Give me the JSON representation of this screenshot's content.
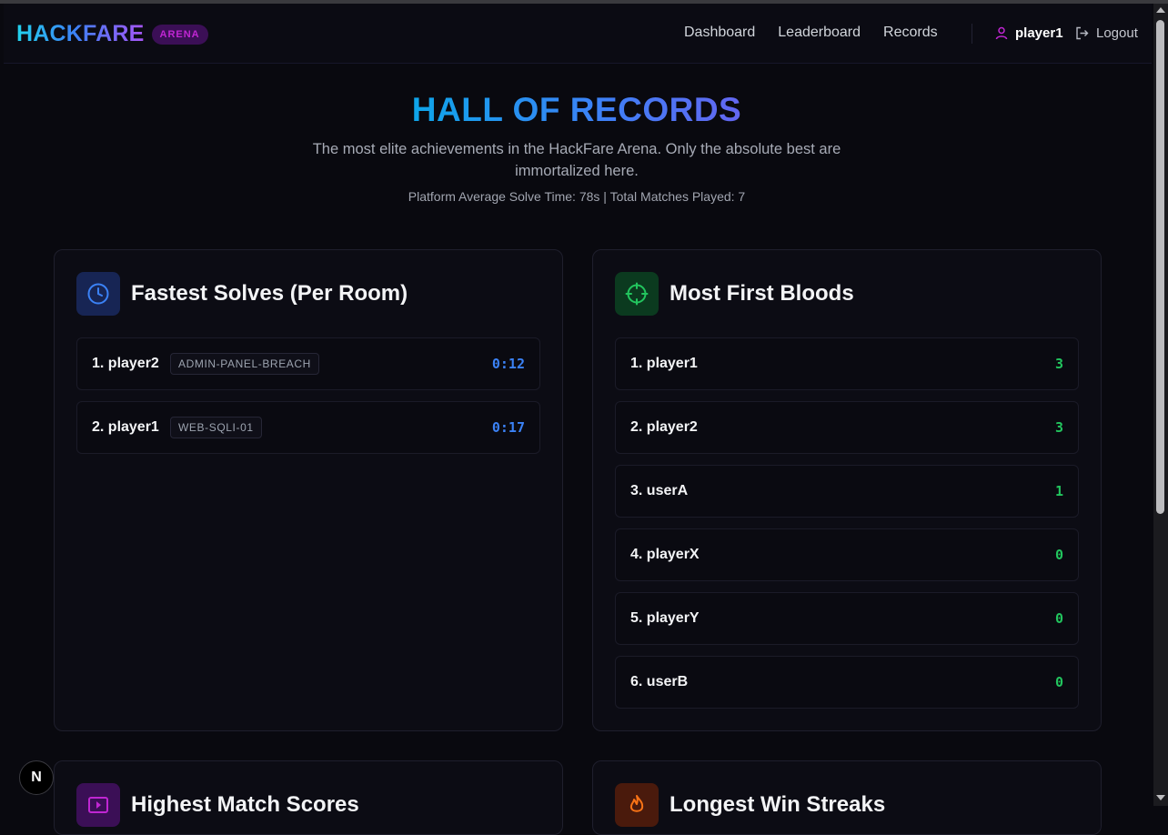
{
  "brand": {
    "name": "HACKFARE",
    "badge": "ARENA"
  },
  "nav": {
    "links": [
      "Dashboard",
      "Leaderboard",
      "Records"
    ],
    "username": "player1",
    "logout_label": "Logout"
  },
  "hero": {
    "title": "HALL OF RECORDS",
    "subtitle": "The most elite achievements in the HackFare Arena. Only the absolute best are immortalized here.",
    "stats": "Platform Average Solve Time: 78s | Total Matches Played: 7"
  },
  "fastest": {
    "title": "Fastest Solves (Per Room)",
    "icon": "clock-icon",
    "accent": "#3b82f6",
    "rows": [
      {
        "name": "1. player2",
        "room": "ADMIN-PANEL-BREACH",
        "time": "0:12"
      },
      {
        "name": "2. player1",
        "room": "WEB-SQLI-01",
        "time": "0:17"
      }
    ]
  },
  "firstbloods": {
    "title": "Most First Bloods",
    "icon": "crosshair-icon",
    "accent": "#22c55e",
    "rows": [
      {
        "name": "1. player1",
        "value": "3"
      },
      {
        "name": "2. player2",
        "value": "3"
      },
      {
        "name": "3. userA",
        "value": "1"
      },
      {
        "name": "4. playerX",
        "value": "0"
      },
      {
        "name": "5. playerY",
        "value": "0"
      },
      {
        "name": "6. userB",
        "value": "0"
      }
    ]
  },
  "highest": {
    "title": "Highest Match Scores",
    "icon": "play-icon",
    "accent": "#a855f7"
  },
  "streaks": {
    "title": "Longest Win Streaks",
    "icon": "flame-icon",
    "accent": "#f97316"
  },
  "fab_label": "N"
}
